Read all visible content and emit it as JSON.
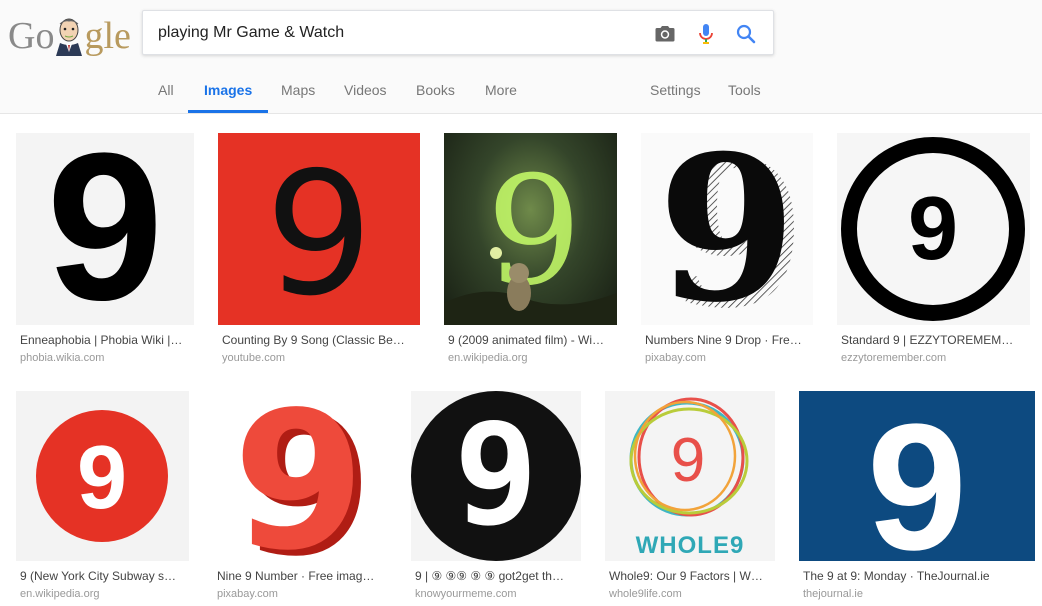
{
  "search": {
    "query": "playing Mr Game & Watch"
  },
  "logo": {
    "letters_left": "Go",
    "letters_right": "gle"
  },
  "tabs": {
    "all": "All",
    "images": "Images",
    "maps": "Maps",
    "videos": "Videos",
    "books": "Books",
    "more": "More",
    "settings": "Settings",
    "tools": "Tools"
  },
  "icons": {
    "camera": "camera-icon",
    "mic": "microphone-icon",
    "search": "search-icon"
  },
  "colors": {
    "accent": "#1a73e8",
    "red": "#e53225",
    "dark_blue": "#0d4a80"
  },
  "results": [
    {
      "title": "Enneaphobia | Phobia Wiki |…",
      "domain": "phobia.wikia.com",
      "glyph": "9"
    },
    {
      "title": "Counting By 9 Song (Classic Be…",
      "domain": "youtube.com",
      "glyph": "9"
    },
    {
      "title": "9 (2009 animated film) - Wi…",
      "domain": "en.wikipedia.org",
      "glyph": "9"
    },
    {
      "title": "Numbers Nine 9 Drop · Fre…",
      "domain": "pixabay.com",
      "glyph": "9"
    },
    {
      "title": "Standard 9 | EZZYTOREMEM…",
      "domain": "ezzytoremember.com",
      "glyph": "9"
    },
    {
      "title": "9 (New York City Subway s…",
      "domain": "en.wikipedia.org",
      "glyph": "9"
    },
    {
      "title": "Nine 9 Number · Free imag…",
      "domain": "pixabay.com",
      "glyph": "9"
    },
    {
      "title": "9 | ⑨ ⑨⑨ ⑨ ⑨ got2get th…",
      "domain": "knowyourmeme.com",
      "glyph": "9"
    },
    {
      "title": "Whole9: Our 9 Factors | W…",
      "domain": "whole9life.com",
      "glyph": "9",
      "brand": "WHOLE9"
    },
    {
      "title": "The 9 at 9: Monday · TheJournal.ie",
      "domain": "thejournal.ie",
      "glyph": "9"
    }
  ]
}
